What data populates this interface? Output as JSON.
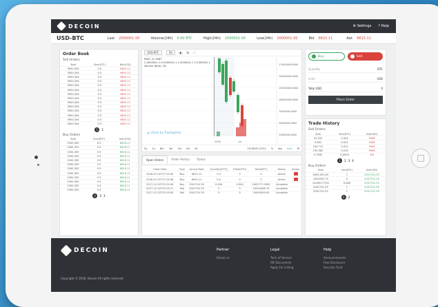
{
  "header": {
    "brand": "DECOIN",
    "settings": "Settings",
    "help": "Help"
  },
  "ticker": {
    "pair": "USD-BTC",
    "last_label": "Last",
    "last": "2000001.00",
    "vol_label": "Volume(24h)",
    "vol": "0.00 BTC",
    "high_label": "High(24h)",
    "high": "2000001.00",
    "low_label": "Low(24h)",
    "low": "2000001.00",
    "bid_label": "Bid",
    "bid": "6615.11",
    "ask_label": "Ask",
    "ask": "6615.11"
  },
  "orderbook": {
    "title": "Order Book",
    "sell_title": "Sell Orders",
    "buy_title": "Buy Orders",
    "headers": [
      "Total",
      "Size(BTC)",
      "Bid(USD)"
    ],
    "sell_rows": [
      [
        "3900,304",
        "0.5",
        "6615.11"
      ],
      [
        "3900,304",
        "0.5",
        "6615.11"
      ],
      [
        "3900,304",
        "0.5",
        "6615.11"
      ],
      [
        "3900,304",
        "0.5",
        "6615.11"
      ],
      [
        "3900,304",
        "0.5",
        "6615.11"
      ],
      [
        "3900,304",
        "0.5",
        "6615.11"
      ],
      [
        "3900,304",
        "0.5",
        "6615.11"
      ],
      [
        "3900,304",
        "0.5",
        "6615.11"
      ],
      [
        "3900,304",
        "0.5",
        "6615.11"
      ],
      [
        "3900,304",
        "0.5",
        "6615.11"
      ],
      [
        "3900,304",
        "0.5",
        "6615.11"
      ],
      [
        "3900,304",
        "0.5",
        "6615.11"
      ],
      [
        "3900,304",
        "0.5",
        "6615.11"
      ],
      [
        "3900,304",
        "0.5",
        "6615.11"
      ]
    ],
    "buy_headers": [
      "Total",
      "Size(BTC)",
      "Ask(USD)"
    ],
    "buy_rows": [
      [
        "2300,305",
        "0.5",
        "6616.11"
      ],
      [
        "2300,305",
        "0.5",
        "6616.11"
      ],
      [
        "2300,305",
        "0.5",
        "6616.11"
      ],
      [
        "2300,305",
        "0.5",
        "6616.11"
      ],
      [
        "2300,305",
        "0.5",
        "6616.11"
      ],
      [
        "2300,305",
        "0.5",
        "6616.11"
      ],
      [
        "2300,305",
        "0.5",
        "6616.11"
      ],
      [
        "2300,305",
        "0.5",
        "6616.11"
      ],
      [
        "2300,305",
        "0.5",
        "6616.11"
      ],
      [
        "2300,305",
        "0.5",
        "6616.11"
      ],
      [
        "2300,305",
        "0.5",
        "6616.11"
      ],
      [
        "2300,305",
        "0.5",
        "6616.11"
      ]
    ],
    "sell_pages": [
      "1",
      "2"
    ],
    "buy_pages": [
      "1",
      "2",
      "3"
    ]
  },
  "chart": {
    "symbol": "USD-BTC",
    "interval": "1H",
    "info1": "PABT, D, PABT",
    "info2": "C:2000001.1 H:2000001.1 L:2000001.1 C:2000001.1",
    "info3": "Volume (Beta, 20)",
    "credit": "charts by TradingView",
    "timeframes": [
      "5y",
      "1y",
      "6m",
      "3m",
      "1m",
      "5d",
      "1d"
    ],
    "time": "15:48:00 (UTC)",
    "opts": [
      "%",
      "log",
      "auto"
    ],
    "price_labels": [
      "175000000.0000",
      "150000000.0000",
      "125000000.0000",
      "100000000.0000",
      "75000000.0000",
      "50000000.0000",
      "25000000.0000"
    ],
    "date_labels": [
      "2018",
      "Jul"
    ]
  },
  "orders": {
    "tabs": [
      "Open Orders",
      "Order History",
      "Status"
    ],
    "headers": [
      "Order Date",
      "Type",
      "Amout Rate",
      "Quantity(ETH)",
      "Filled(ETH)",
      "Total(BTC)",
      "Status",
      "Action"
    ],
    "rows": [
      [
        "2018-07-02T17:23:49",
        "Buy",
        "6615.11",
        "0.5",
        "0",
        "0",
        "Active"
      ],
      [
        "2018-07-02T17:13:58",
        "Buy",
        "6615.11",
        "0.5",
        "0",
        "0",
        "Active"
      ],
      [
        "2017-12-20T15:23:40",
        "Buy",
        "2001701.55",
        "0.004",
        "0.004",
        "2005777.0563",
        "Complete"
      ],
      [
        "2017-12-20T15:23:11",
        "Sell",
        "2001701.55",
        "5",
        "5",
        "10014048.75",
        "Complete"
      ],
      [
        "2017-12-20T15:23:00",
        "Sell",
        "2001701.55",
        "5",
        "5",
        "20000000.00",
        "Complete"
      ]
    ]
  },
  "form": {
    "buy": "Buy",
    "sell": "Sell",
    "quantity_label": "Quantity",
    "quantity_unit": "BTC",
    "limit_label": "Limit",
    "limit_unit": "USD",
    "total_label": "Total USD",
    "total": "0",
    "place": "Place Order"
  },
  "history": {
    "title": "Trade History",
    "sell_title": "Sell Orders",
    "headers": [
      "Total",
      "Size(BTC)",
      "Bid(USD)"
    ],
    "sell_rows": [
      [
        "22.532",
        "0.004",
        "9981"
      ],
      [
        "9.892",
        "0.001",
        "9981"
      ],
      [
        "144.712",
        "0.411",
        "9981"
      ],
      [
        "135.362",
        "0.014",
        "9981"
      ],
      [
        "5.7645",
        "0.0003",
        "8.6"
      ]
    ],
    "buy_title": "Buy Orders",
    "buy_headers": [
      "Total",
      "Size(BTC)",
      "Ask(USD)"
    ],
    "buy_rows": [
      [
        "4000,053.05",
        "1",
        "2001701.55"
      ],
      [
        "1601067.75",
        "0",
        "2001701.55"
      ],
      [
        "100000.7752",
        "0.084",
        "2001701.55"
      ],
      [
        "2001701.55",
        "1",
        "2001701.55"
      ],
      [
        "2001701.55",
        "1",
        "2001701.55"
      ]
    ],
    "sell_pages": [
      "1",
      "2",
      "3",
      "4"
    ],
    "buy_pages": [
      "1",
      "2"
    ]
  },
  "footer": {
    "brand": "DECOIN",
    "copyright": "Copyright © 2018. Decoin All rights reserved.",
    "cols": [
      {
        "head": "Partner",
        "items": [
          "Decoin.io"
        ]
      },
      {
        "head": "Legal",
        "items": [
          "Term of Service",
          "API Documents",
          "Apply For Listing"
        ]
      },
      {
        "head": "Help",
        "items": [
          "Announcements",
          "Fees Disclosure",
          "Security Fund"
        ]
      }
    ]
  },
  "colors": {
    "red": "#d9433c",
    "green": "#3ba55d",
    "dark": "#2e3236"
  }
}
